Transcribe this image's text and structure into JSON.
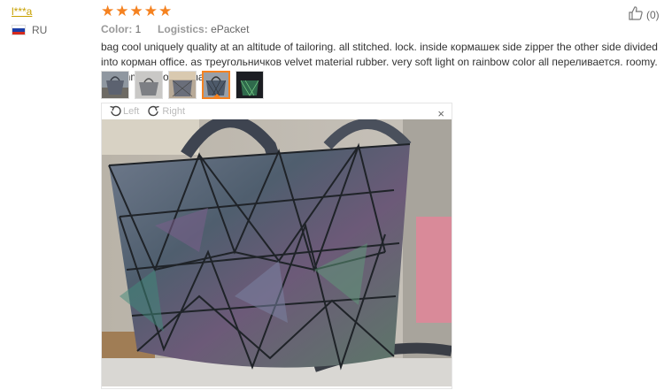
{
  "review": {
    "user_name": "l***a",
    "country": "RU",
    "rating": 5,
    "color_label": "Color:",
    "color_value": "1",
    "logistics_label": "Logistics:",
    "logistics_value": "ePacket",
    "text": "bag cool uniquely quality at an altitude of tailoring. all stitched. lock. inside кормашек side zipper the other side divided into корман office. as треугольничков velvet material rubber. very soft light on rainbow color all переливается. roomy. recommend to purchase.",
    "helpful_count": "(0)"
  },
  "thumbnails": [
    {
      "icon": "photo-bag-outdoor",
      "active": false
    },
    {
      "icon": "photo-bag-grey",
      "active": false
    },
    {
      "icon": "photo-bag-shelf",
      "active": false
    },
    {
      "icon": "photo-bag-hologram",
      "active": true
    },
    {
      "icon": "photo-bag-dark",
      "active": false
    }
  ],
  "viewer": {
    "left_label": "Left",
    "right_label": "Right",
    "close_symbol": "×"
  },
  "colors": {
    "star": "#f58220",
    "username": "#c7a000",
    "accent": "#f58220"
  }
}
